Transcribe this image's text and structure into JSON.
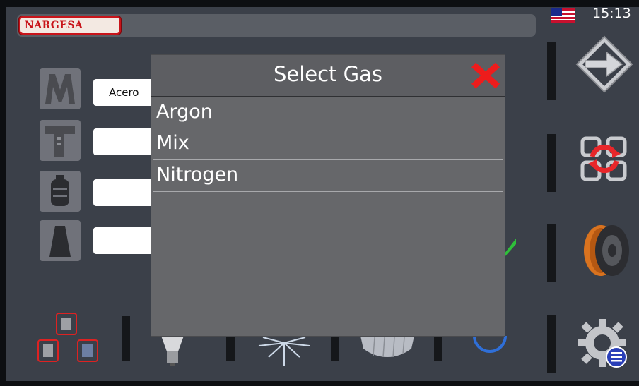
{
  "header": {
    "brand": "NARGESA",
    "time": "15:13",
    "language_flag": "us-flag-icon"
  },
  "left_panel": {
    "material_field_value": "Acero",
    "icons": [
      "material-icon",
      "caliper-icon",
      "gas-bottle-icon",
      "nozzle-icon"
    ]
  },
  "right_panel": {
    "icons": [
      "next-arrow-icon",
      "refresh-cycle-icon",
      "wire-spool-icon",
      "settings-gear-icon"
    ]
  },
  "bottom_bar": {
    "icons": [
      "layout-icon",
      "light-bulb-icon",
      "spark-icon",
      "spring-icon",
      "ring-icon"
    ]
  },
  "dialog": {
    "title": "Select Gas",
    "options": [
      "Argon",
      "Mix",
      "Nitrogen"
    ]
  },
  "colors": {
    "accent_red": "#ee1c1c",
    "background": "#3b4049",
    "dialog": "#66676a"
  }
}
